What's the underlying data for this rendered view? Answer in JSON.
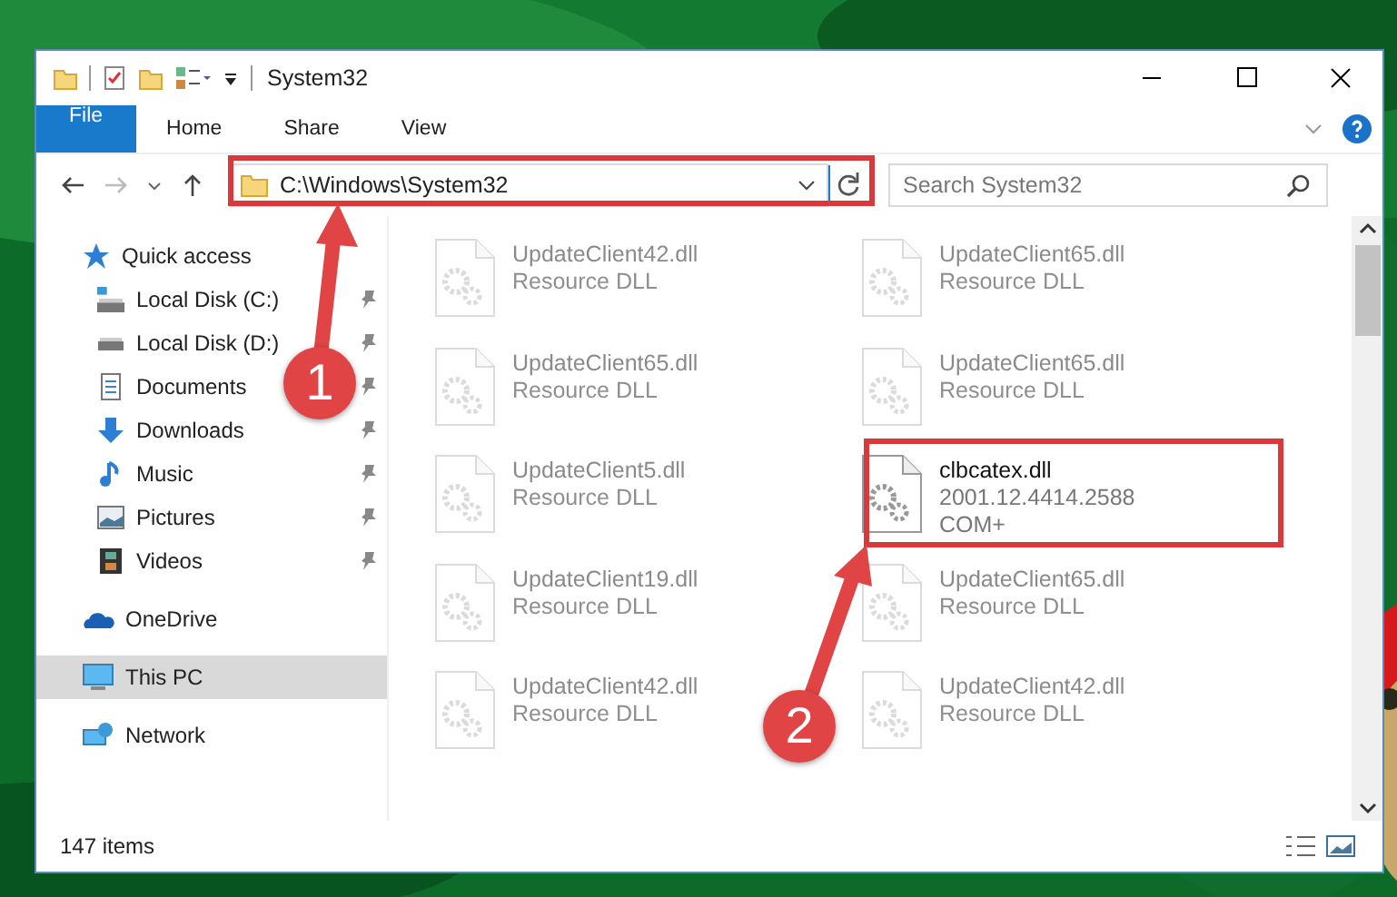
{
  "window": {
    "title": "System32"
  },
  "ribbon_tabs": [
    {
      "label": "File",
      "selected": true
    },
    {
      "label": "Home",
      "selected": false
    },
    {
      "label": "Share",
      "selected": false
    },
    {
      "label": "View",
      "selected": false
    }
  ],
  "address_bar": {
    "path": "C:\\Windows\\System32"
  },
  "search": {
    "placeholder": "Search System32"
  },
  "sidebar": {
    "items": [
      {
        "label": "Quick access",
        "selected": false,
        "children": [
          {
            "label": "Local Disk (C:)",
            "selected": false,
            "pinned": true
          },
          {
            "label": "Local Disk (D:)",
            "selected": false,
            "pinned": true
          },
          {
            "label": "Documents",
            "selected": false,
            "pinned": true
          },
          {
            "label": "Downloads",
            "selected": false,
            "pinned": true
          },
          {
            "label": "Music",
            "selected": false,
            "pinned": true
          },
          {
            "label": "Pictures",
            "selected": false,
            "pinned": true
          },
          {
            "label": "Videos",
            "selected": false,
            "pinned": true
          }
        ]
      },
      {
        "label": "OneDrive",
        "selected": false
      },
      {
        "label": "This PC",
        "selected": true
      },
      {
        "label": "Network",
        "selected": false
      }
    ]
  },
  "files": [
    {
      "name": "UpdateClient42.dll",
      "lines": [
        "Resource DLL"
      ],
      "kind": "faded"
    },
    {
      "name": "UpdateClient65.dll",
      "lines": [
        "Resource DLL"
      ],
      "kind": "faded"
    },
    {
      "name": "UpdateClient65.dll",
      "lines": [
        "Resource DLL"
      ],
      "kind": "faded"
    },
    {
      "name": "UpdateClient65.dll",
      "lines": [
        "Resource DLL"
      ],
      "kind": "faded"
    },
    {
      "name": "UpdateClient5.dll",
      "lines": [
        "Resource DLL"
      ],
      "kind": "faded"
    },
    {
      "name": "clbcatex.dll",
      "lines": [
        "2001.12.4414.2588",
        "COM+"
      ],
      "kind": "normal"
    },
    {
      "name": "UpdateClient19.dll",
      "lines": [
        "Resource DLL"
      ],
      "kind": "faded"
    },
    {
      "name": "UpdateClient65.dll",
      "lines": [
        "Resource DLL"
      ],
      "kind": "faded"
    },
    {
      "name": "UpdateClient42.dll",
      "lines": [
        "Resource DLL"
      ],
      "kind": "faded"
    },
    {
      "name": "UpdateClient42.dll",
      "lines": [
        "Resource DLL"
      ],
      "kind": "faded"
    }
  ],
  "status_bar": {
    "item_count": "147 items"
  },
  "callouts": [
    {
      "number": "1"
    },
    {
      "number": "2"
    }
  ]
}
